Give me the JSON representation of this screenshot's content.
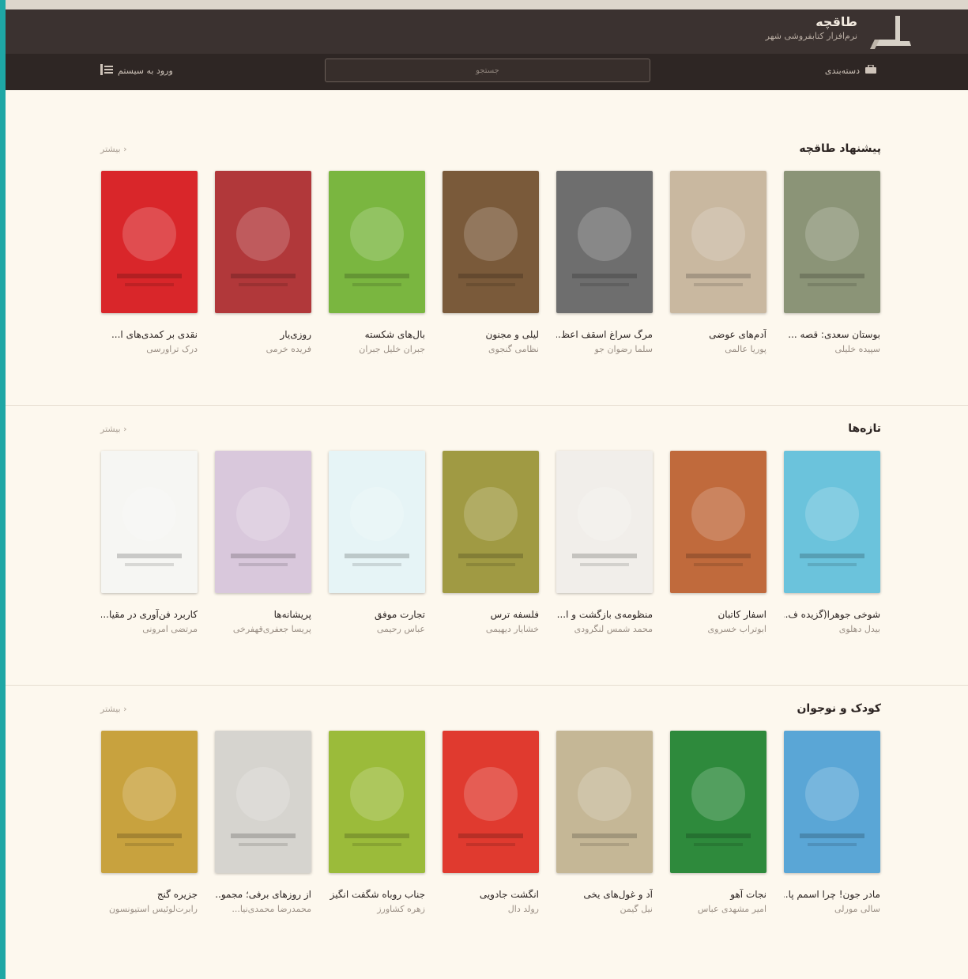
{
  "header": {
    "title": "طاقچه",
    "subtitle": "نرم‌افزار کتابفروشی شهر"
  },
  "toolbar": {
    "categories_label": "دسته‌بندی",
    "search_placeholder": "جستجو",
    "login_label": "ورود به سیستم"
  },
  "sections": [
    {
      "title": "پیشنهاد طاقچه",
      "more": "بیشتر",
      "books": [
        {
          "title": "بوستان سعدی: قصه ...",
          "author": "سپیده خلیلی",
          "color": "#8b9477"
        },
        {
          "title": "آدم‌های عوضی",
          "author": "پوریا عالمی",
          "color": "#c9b8a0"
        },
        {
          "title": "مرگ سراغ اسقف اعظ...",
          "author": "سلما رضوان جو",
          "color": "#6e6e6e"
        },
        {
          "title": "لیلی و مجنون",
          "author": "نظامی گنجوی",
          "color": "#7a5a3a"
        },
        {
          "title": "بال‌های شکسته",
          "author": "جبران خلیل جبران",
          "color": "#7ab640"
        },
        {
          "title": "روزی‌یار",
          "author": "فریده خرمی",
          "color": "#b1383a"
        },
        {
          "title": "نقدی بر کمدی‌های ا...",
          "author": "درک تراورسی",
          "color": "#d9262a"
        }
      ]
    },
    {
      "title": "تازه‌ها",
      "more": "بیشتر",
      "books": [
        {
          "title": "شوخی جوهرا(گزیده ف...",
          "author": "بیدل دهلوی",
          "color": "#6bc3dc"
        },
        {
          "title": "اسفار کاتبان",
          "author": "ابوتراب خسروی",
          "color": "#c06a3c"
        },
        {
          "title": "منظومه‌ی بازگشت و ا...",
          "author": "محمد شمس لنگرودی",
          "color": "#f1eeea"
        },
        {
          "title": "فلسفه ترس",
          "author": "خشایار دیهیمی",
          "color": "#a09a43"
        },
        {
          "title": "تجارت موفق",
          "author": "عباس رحیمی",
          "color": "#e6f4f6"
        },
        {
          "title": "پریشانه‌ها",
          "author": "پریسا جعفری‌قهفرخی",
          "color": "#d9c8dc"
        },
        {
          "title": "کاربرد فن‌آوری در مقیا...",
          "author": "مرتضی امرونی",
          "color": "#f6f6f3"
        }
      ]
    },
    {
      "title": "کودک و نوجوان",
      "more": "بیشتر",
      "books": [
        {
          "title": "مادر جون! چرا اسمم پا...",
          "author": "سالی مورلی",
          "color": "#5aa6d6"
        },
        {
          "title": "نجات آهو",
          "author": "امیر مشهدی عباس",
          "color": "#2e8a3c"
        },
        {
          "title": "آد و غول‌های یخی",
          "author": "نیل گیمن",
          "color": "#c5b796"
        },
        {
          "title": "انگشت جادویی",
          "author": "رولد دال",
          "color": "#e03a2f"
        },
        {
          "title": "جناب روباه شگفت انگیز",
          "author": "زهره کشاورز",
          "color": "#9bbb3a"
        },
        {
          "title": "از روزهای برفی؛ مجمو...",
          "author": "محمدرضا محمدی‌نیا...",
          "color": "#d6d4cf"
        },
        {
          "title": "جزیره گنج",
          "author": "رابرت‌لوئیس استیونسون",
          "color": "#c8a23e"
        }
      ]
    }
  ],
  "colors": {
    "header_bg": "#3b3230",
    "toolbar_bg": "#2e2624",
    "page_bg": "#fdf8ee",
    "accent": "#1ea7a5"
  }
}
